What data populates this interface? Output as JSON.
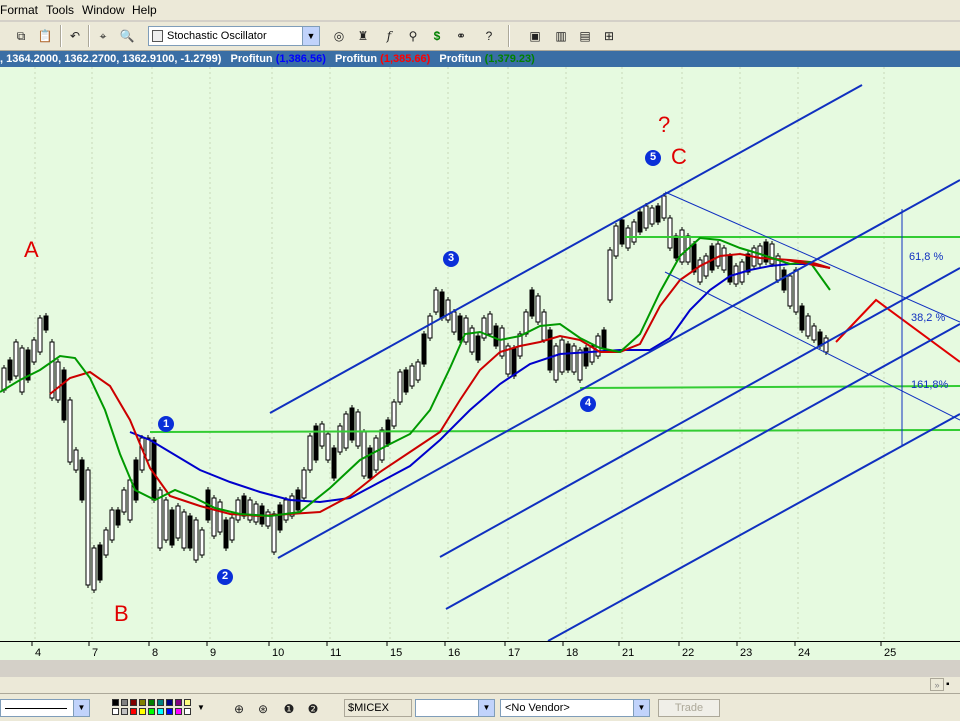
{
  "menu": {
    "format": "Format",
    "tools": "Tools",
    "window": "Window",
    "help": "Help"
  },
  "toolbar": {
    "indicator_select": "Stochastic Oscillator"
  },
  "infobar": {
    "values": ", 1364.2000, 1362.2700, 1362.9100, -1.2799)",
    "p1_label": "Profitun",
    "p1_value": "(1,386.56)",
    "p2_label": "Profitun",
    "p2_value": "(1,385.66)",
    "p3_label": "Profitun",
    "p3_value": "(1,379.23)",
    "colors": {
      "p1": "#0000ff",
      "p2": "#ff0000",
      "p3": "#008000"
    }
  },
  "chart": {
    "labels": {
      "A": "A",
      "B": "B",
      "C": "C",
      "question": "?",
      "w1": "1",
      "w2": "2",
      "w3": "3",
      "w4": "4",
      "w5": "5"
    },
    "fib": {
      "f618": "61,8 %",
      "f382": "38,2 %",
      "f1618": "161,8%"
    },
    "x_ticks": [
      "4",
      "7",
      "8",
      "9",
      "10",
      "11",
      "15",
      "16",
      "17",
      "18",
      "21",
      "22",
      "23",
      "24",
      "25"
    ]
  },
  "bottom": {
    "symbol": "$MICEX",
    "vendor": "<No Vendor>",
    "trade": "Trade"
  }
}
